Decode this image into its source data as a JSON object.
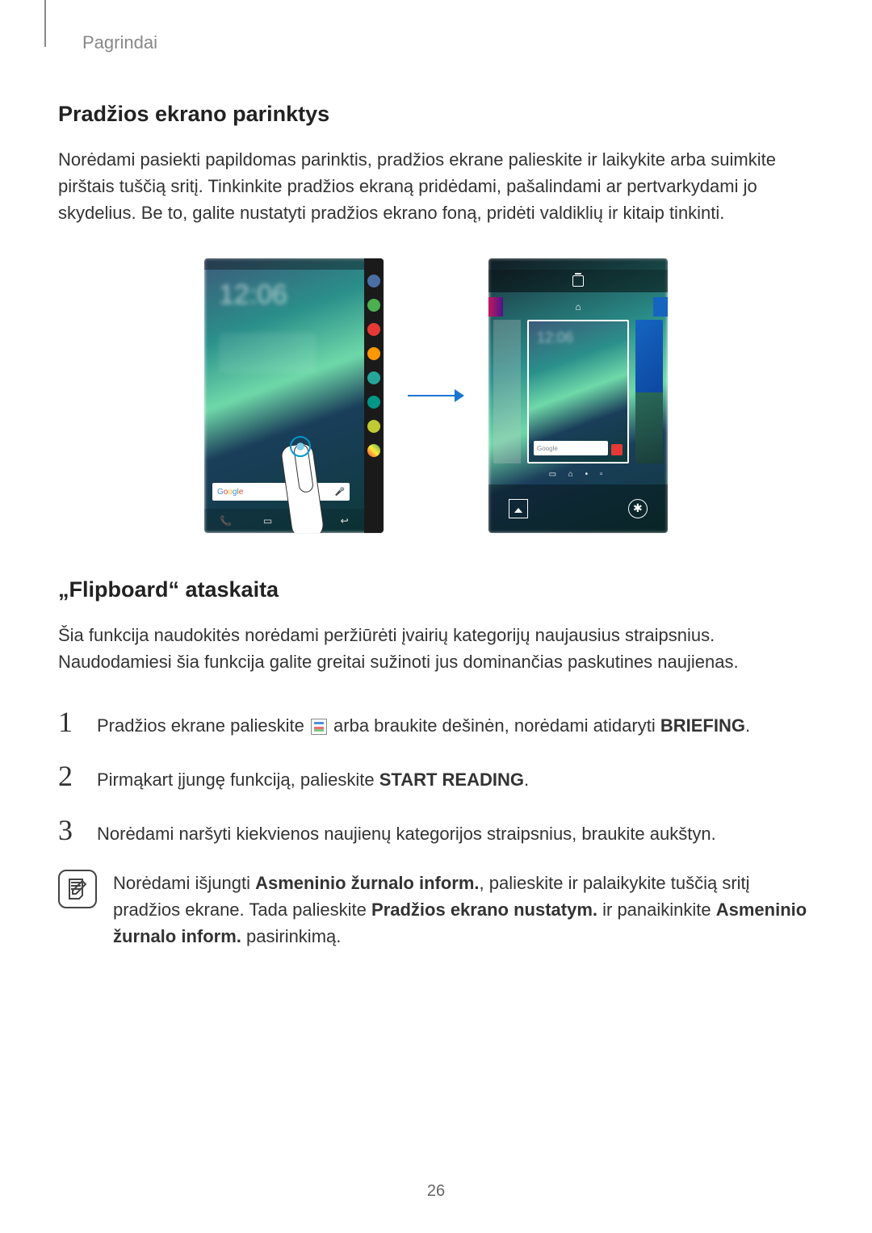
{
  "breadcrumb": "Pagrindai",
  "section1": {
    "heading": "Pradžios ekrano parinktys",
    "body": "Norėdami pasiekti papildomas parinktis, pradžios ekrane palieskite ir laikykite arba suimkite pirštais tuščią sritį. Tinkinkite pradžios ekraną pridėdami, pašalindami ar pertvarkydami jo skydelius. Be to, galite nustatyti pradžios ekrano foną, pridėti valdiklių ir kitaip tinkinti."
  },
  "figure": {
    "left_time": "12:06",
    "right_time": "12:06",
    "search_brand": "Google",
    "search_hint": "Google"
  },
  "section2": {
    "heading": "„Flipboard“ ataskaita",
    "body": "Šia funkcija naudokitės norėdami peržiūrėti įvairių kategorijų naujausius straipsnius. Naudodamiesi šia funkcija galite greitai sužinoti jus dominančias paskutines naujienas."
  },
  "steps": {
    "s1_a": "Pradžios ekrane palieskite ",
    "s1_b": " arba braukite dešinėn, norėdami atidaryti ",
    "s1_bold": "BRIEFING",
    "s1_c": ".",
    "s2_a": "Pirmąkart įjungę funkciją, palieskite ",
    "s2_bold": "START READING",
    "s2_c": ".",
    "s3": "Norėdami naršyti kiekvienos naujienų kategorijos straipsnius, braukite aukštyn."
  },
  "note": {
    "a": "Norėdami išjungti ",
    "b1": "Asmeninio žurnalo inform.",
    "c": ", palieskite ir palaikykite tuščią sritį pradžios ekrane. Tada palieskite ",
    "b2": "Pradžios ekrano nustatym.",
    "d": " ir panaikinkite ",
    "b3": "Asmeninio žurnalo inform.",
    "e": " pasirinkimą."
  },
  "page_number": "26"
}
